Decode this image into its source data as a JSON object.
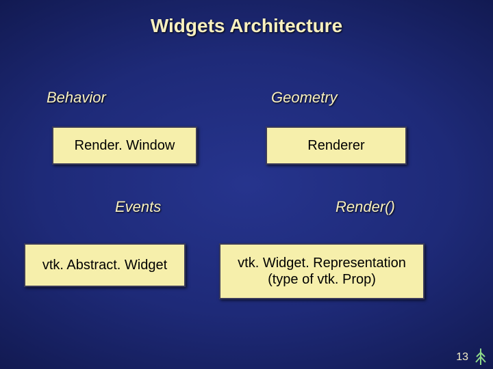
{
  "title": "Widgets Architecture",
  "columns": {
    "left_label": "Behavior",
    "right_label": "Geometry"
  },
  "boxes": {
    "render_window": "Render. Window",
    "renderer": "Renderer",
    "abstract_widget": "vtk. Abstract. Widget",
    "widget_representation_line1": "vtk. Widget. Representation",
    "widget_representation_line2": "(type of vtk. Prop)"
  },
  "arrows": {
    "events_label": "Events",
    "render_label": "Render()"
  },
  "page_number": "13"
}
